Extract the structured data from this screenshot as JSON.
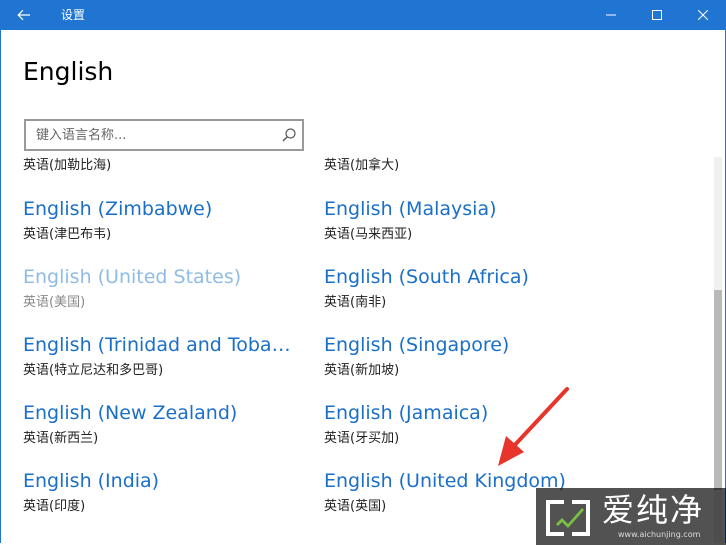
{
  "window": {
    "title": "设置",
    "controls": {
      "minimize": "minimize",
      "maximize": "maximize",
      "close": "close"
    }
  },
  "page": {
    "title": "English"
  },
  "search": {
    "placeholder": "键入语言名称..."
  },
  "languages": [
    {
      "name": "",
      "native": "英语(加勒比海)",
      "state": "normal"
    },
    {
      "name": "",
      "native": "英语(加拿大)",
      "state": "normal"
    },
    {
      "name": "English (Zimbabwe)",
      "native": "英语(津巴布韦)",
      "state": "normal"
    },
    {
      "name": "English (Malaysia)",
      "native": "英语(马来西亚)",
      "state": "normal"
    },
    {
      "name": "English (United States)",
      "native": "英语(美国)",
      "state": "disabled"
    },
    {
      "name": "English (South Africa)",
      "native": "英语(南非)",
      "state": "normal"
    },
    {
      "name": "English (Trinidad and Tobago)",
      "native": "英语(特立尼达和多巴哥)",
      "state": "normal"
    },
    {
      "name": "English (Singapore)",
      "native": "英语(新加坡)",
      "state": "normal"
    },
    {
      "name": "English (New Zealand)",
      "native": "英语(新西兰)",
      "state": "normal"
    },
    {
      "name": "English (Jamaica)",
      "native": "英语(牙买加)",
      "state": "normal"
    },
    {
      "name": "English (India)",
      "native": "英语(印度)",
      "state": "normal"
    },
    {
      "name": "English (United Kingdom)",
      "native": "英语(英国)",
      "state": "normal"
    }
  ],
  "watermark": {
    "text": "爱纯净",
    "url": "www.aichunjing.com"
  },
  "colors": {
    "titlebar": "#1f75d1",
    "link": "#1a6fc9",
    "link_disabled": "#8fbce6",
    "annotation_arrow": "#e8352b"
  },
  "icons": {
    "back": "back-arrow-icon",
    "search": "search-icon",
    "minimize": "minimize-icon",
    "maximize": "maximize-icon",
    "close": "close-icon"
  }
}
